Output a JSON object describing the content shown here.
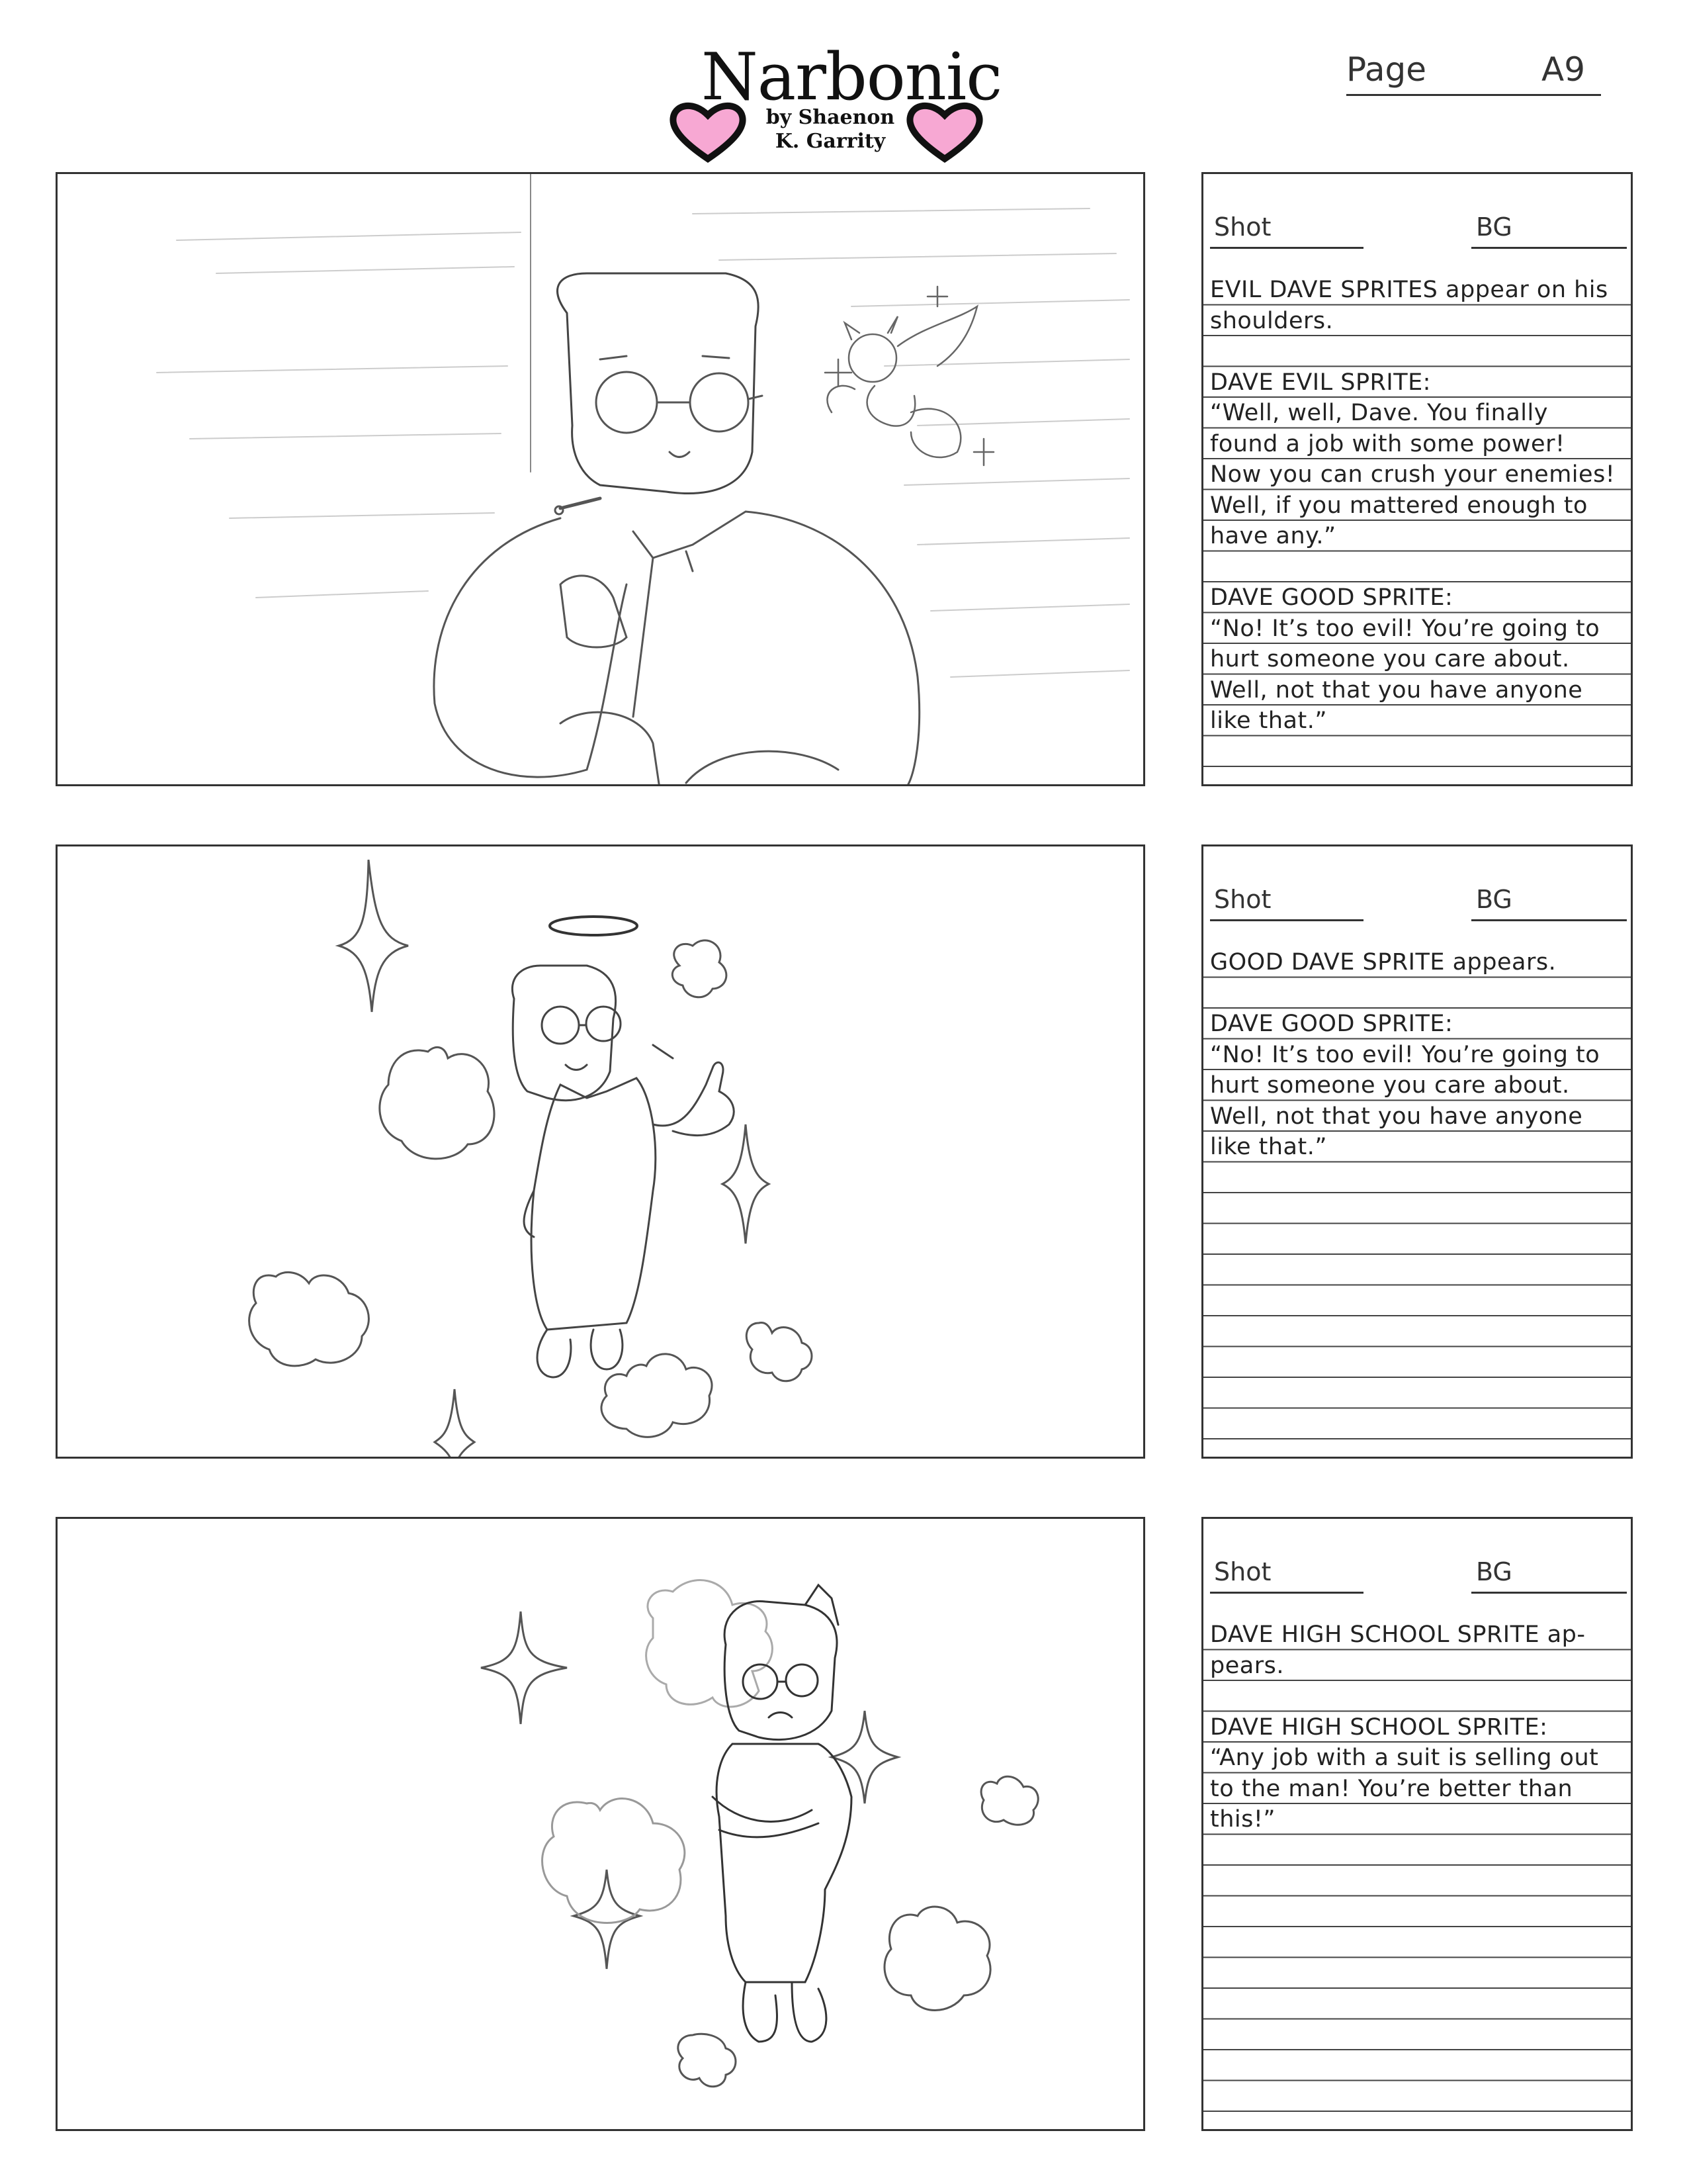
{
  "header": {
    "logo": {
      "title": "Narbonic",
      "byline_1": "by Shaenon",
      "byline_2": "K. Garrity",
      "heart_color": "#f7a8d3",
      "heart_outline": "#111111"
    },
    "page_label": "Page",
    "page_value": "A9"
  },
  "panels": [
    {
      "shot_label": "Shot",
      "bg_label": "BG",
      "art": "evil-sprite-on-shoulder",
      "lines": [
        "EVIL DAVE SPRITES appear on his",
        "shoulders.",
        "",
        "DAVE EVIL SPRITE:",
        "“Well, well, Dave. You finally",
        "found a job with some power!",
        "Now you can crush your enemies!",
        "Well, if you mattered enough to",
        "have any.”",
        "",
        "DAVE GOOD SPRITE:",
        "“No! It’s too evil! You’re going to",
        "hurt someone you care about.",
        "Well, not that you have anyone",
        "like that.”"
      ]
    },
    {
      "shot_label": "Shot",
      "bg_label": "BG",
      "art": "good-sprite-with-halo",
      "lines": [
        "GOOD DAVE SPRITE appears.",
        "",
        "DAVE GOOD SPRITE:",
        "“No! It’s too evil! You’re going to",
        "hurt someone you care about.",
        "Well, not that you have anyone",
        "like that.”"
      ]
    },
    {
      "shot_label": "Shot",
      "bg_label": "BG",
      "art": "high-school-sprite",
      "lines": [
        "DAVE HIGH SCHOOL SPRITE ap-",
        "pears.",
        "",
        "DAVE HIGH SCHOOL SPRITE:",
        "“Any job with a suit is selling out",
        "to the man! You’re better than",
        "this!”"
      ]
    }
  ]
}
